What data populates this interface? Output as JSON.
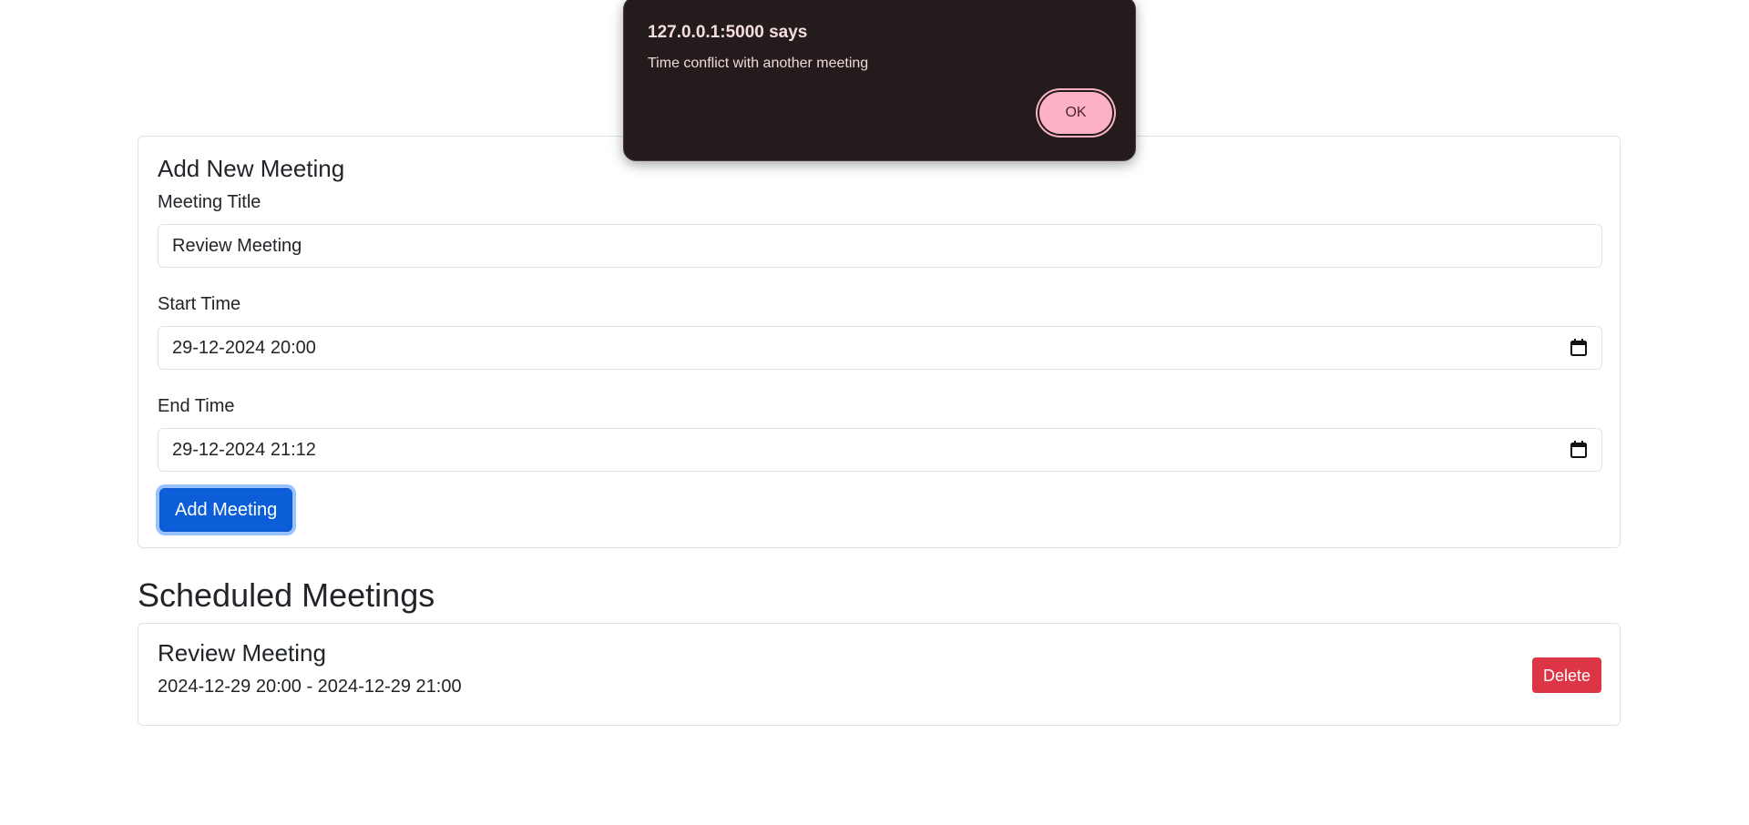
{
  "dialog": {
    "origin": "127.0.0.1:5000 says",
    "message": "Time conflict with another meeting",
    "ok_label": "OK"
  },
  "add_form": {
    "title": "Add New Meeting",
    "meeting_title_label": "Meeting Title",
    "meeting_title_value": "Review Meeting",
    "start_label": "Start Time",
    "start_value": "29-12-2024 20:00",
    "end_label": "End Time",
    "end_value": "29-12-2024 21:12",
    "submit_label": "Add Meeting"
  },
  "scheduled": {
    "heading": "Scheduled Meetings",
    "meetings": [
      {
        "title": "Review Meeting",
        "time_range": "2024-12-29 20:00 - 2024-12-29 21:00",
        "delete_label": "Delete"
      }
    ]
  },
  "colors": {
    "primary": "#0b5ed7",
    "danger": "#dc3545",
    "dialog_bg": "#231b1c",
    "dialog_button": "#fdb1c6"
  },
  "icons": {
    "start_picker": "calendar-icon",
    "end_picker": "calendar-icon"
  }
}
